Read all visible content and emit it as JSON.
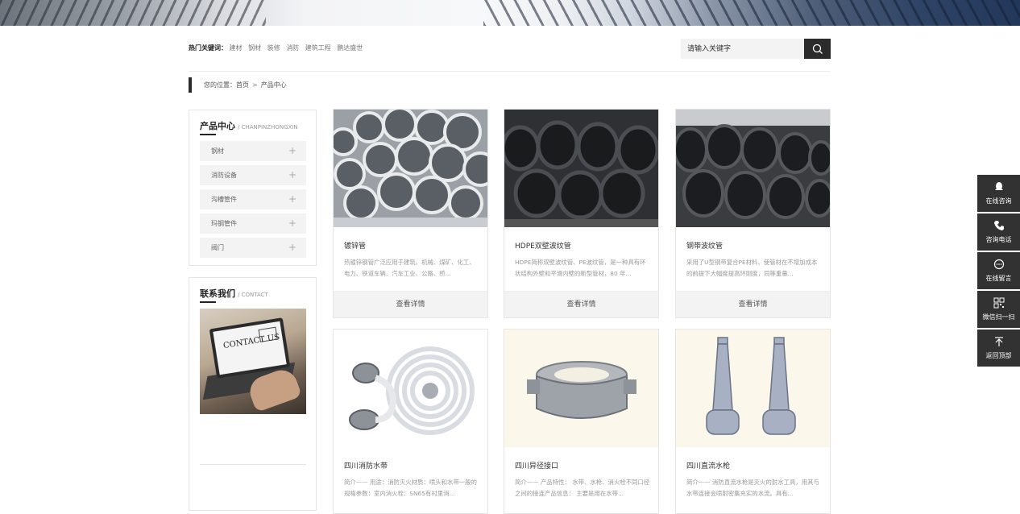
{
  "hot_keywords": {
    "title": "热门关键词：",
    "words": [
      "建材",
      "钢材",
      "装修",
      "消防",
      "建筑工程",
      "鹏达盛世"
    ]
  },
  "search": {
    "placeholder": "请输入关键字"
  },
  "breadcrumb": {
    "label": "您的位置：",
    "home": "首页",
    "separator": ">",
    "current": "产品中心"
  },
  "sidebar": {
    "products": {
      "title": "产品中心",
      "subtitle": "/ CHANPINZHONGXIN",
      "items": [
        {
          "label": "钢材",
          "toggle": "+"
        },
        {
          "label": "消防设备",
          "toggle": "+"
        },
        {
          "label": "沟槽管件",
          "toggle": "+"
        },
        {
          "label": "玛钢管件",
          "toggle": "+"
        },
        {
          "label": "阀门",
          "toggle": "+"
        }
      ]
    },
    "contact": {
      "title": "联系我们",
      "subtitle": "/ CONTACT",
      "image_text": "CONTACT US"
    }
  },
  "products": [
    {
      "title": "镀锌管",
      "desc": "热镀锌钢管广泛应用于建筑、机械、煤矿、化工、电力、铁道车辆、汽车工业、公路、桥...",
      "button": "查看详情"
    },
    {
      "title": "HDPE双壁波纹管",
      "desc": "HDPE简称双壁波纹管、PE波纹管，是一种具有环状结构外壁和平滑内壁的新型管材，80 年...",
      "button": "查看详情"
    },
    {
      "title": "钢带波纹管",
      "desc": "采用了U型钢带复合PE材料、使管材在不增加成本的前提下大幅度提高环刚度，同等重量...",
      "button": "查看详情"
    },
    {
      "title": "四川消防水带",
      "desc": "简介—— 用途：消防灭火材质：喷头和水带一般的规格参数：室内消火栓：SN65有衬里消...",
      "button": "查看详情"
    },
    {
      "title": "四川异径接口",
      "desc": "简介—— 产品特性： 水带、水枪、消火栓不同口径之间的接连产品信息： 主要是用在水带...",
      "button": "查看详情"
    },
    {
      "title": "四川直流水枪",
      "desc": "简介—— 消防直流水枪是灭火的射水工具，用其与水带连接会喷射密集充实的水流。具有...",
      "button": "查看详情"
    }
  ],
  "float_bar": [
    {
      "label": "在线咨询",
      "icon": "qq-icon"
    },
    {
      "label": "咨询电话",
      "icon": "phone-icon"
    },
    {
      "label": "在线留言",
      "icon": "message-icon"
    },
    {
      "label": "微信扫一扫",
      "icon": "qrcode-icon"
    },
    {
      "label": "返回顶部",
      "icon": "back-to-top-icon"
    }
  ],
  "colors": {
    "dark": "#2b2b2b",
    "float_bg": "#323232",
    "light_bg": "#f3f3f3"
  }
}
